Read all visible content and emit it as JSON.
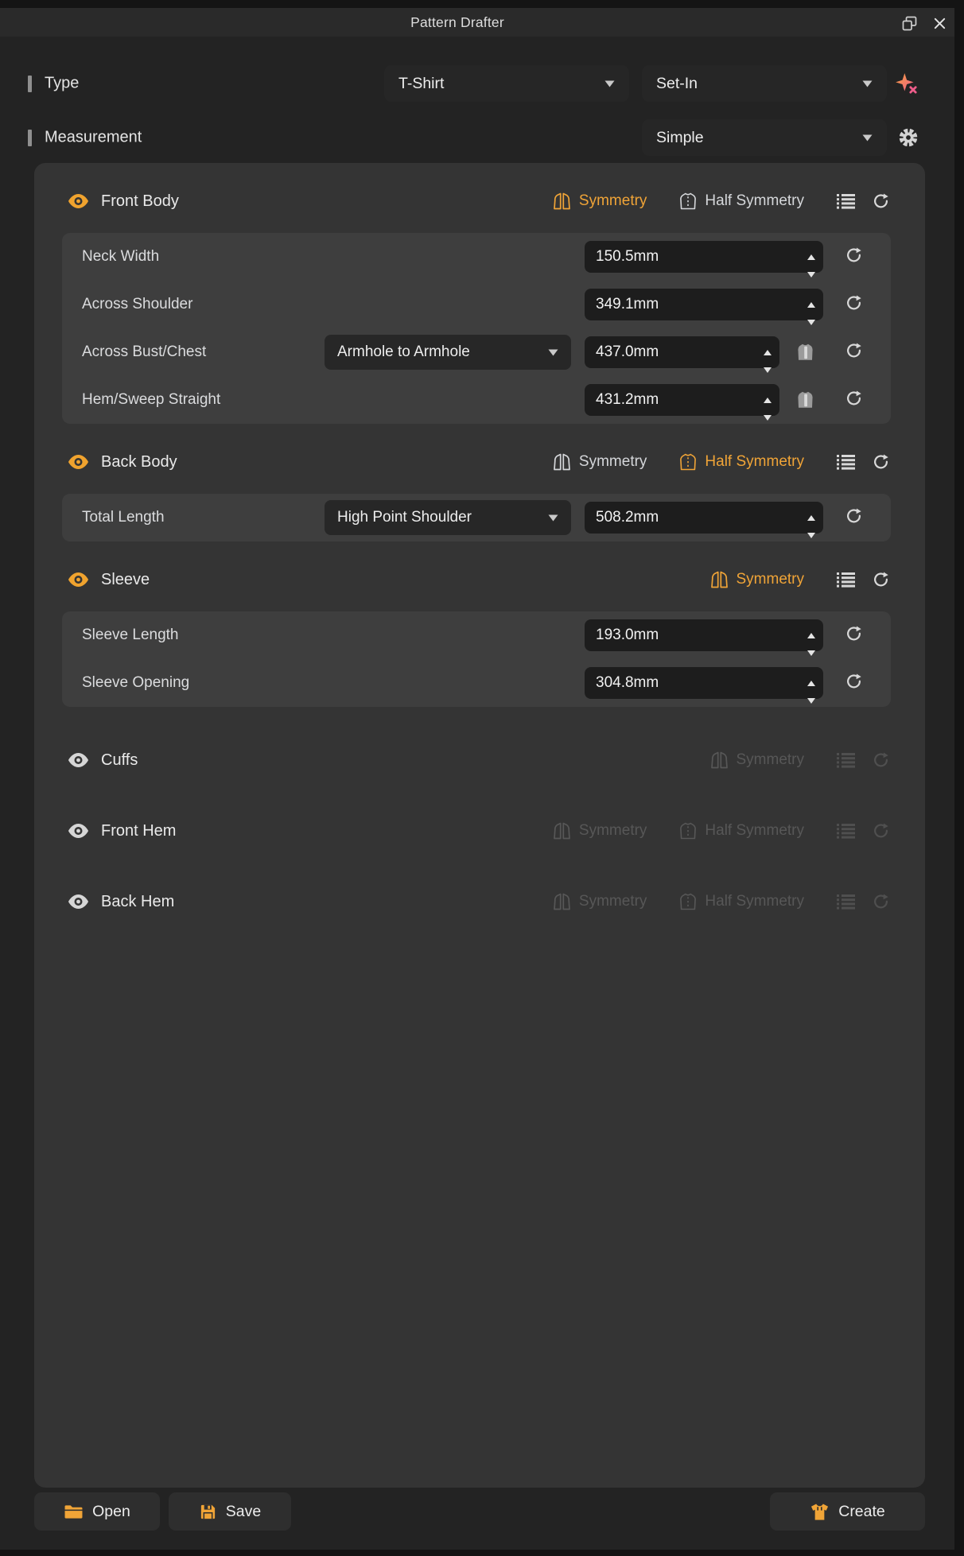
{
  "window": {
    "title": "Pattern Drafter"
  },
  "colors": {
    "accent": "#f0a437",
    "inactive_toggle": "#d5d7da",
    "disabled": "#575757"
  },
  "type_row": {
    "label": "Type",
    "garment_type": "T-Shirt",
    "sleeve_style": "Set-In"
  },
  "measurement_row": {
    "label": "Measurement",
    "mode": "Simple"
  },
  "labels": {
    "symmetry": "Symmetry",
    "half_symmetry": "Half Symmetry"
  },
  "sections": [
    {
      "title": "Front Body",
      "eye": "orange",
      "symmetry": "active",
      "half_symmetry": "inactive",
      "tools": "enabled",
      "rows": [
        {
          "label": "Neck Width",
          "value": "150.5mm"
        },
        {
          "label": "Across Shoulder",
          "value": "349.1mm"
        },
        {
          "label": "Across Bust/Chest",
          "reference": "Armhole to Armhole",
          "value": "437.0mm",
          "measure_icon": true
        },
        {
          "label": "Hem/Sweep Straight",
          "value": "431.2mm",
          "measure_icon": true
        }
      ]
    },
    {
      "title": "Back Body",
      "eye": "orange",
      "symmetry": "inactive",
      "half_symmetry": "active",
      "tools": "enabled",
      "rows": [
        {
          "label": "Total Length",
          "reference": "High Point Shoulder",
          "value": "508.2mm"
        }
      ]
    },
    {
      "title": "Sleeve",
      "eye": "orange",
      "symmetry": "active",
      "half_symmetry": "none",
      "tools": "enabled",
      "rows": [
        {
          "label": "Sleeve Length",
          "value": "193.0mm"
        },
        {
          "label": "Sleeve Opening",
          "value": "304.8mm"
        }
      ]
    },
    {
      "title": "Cuffs",
      "eye": "white",
      "symmetry": "disabled",
      "half_symmetry": "none",
      "tools": "disabled",
      "rows": []
    },
    {
      "title": "Front Hem",
      "eye": "white",
      "symmetry": "disabled",
      "half_symmetry": "disabled",
      "tools": "disabled",
      "rows": []
    },
    {
      "title": "Back Hem",
      "eye": "white",
      "symmetry": "disabled",
      "half_symmetry": "disabled",
      "tools": "disabled",
      "rows": []
    }
  ],
  "footer": {
    "open": "Open",
    "save": "Save",
    "create": "Create"
  }
}
